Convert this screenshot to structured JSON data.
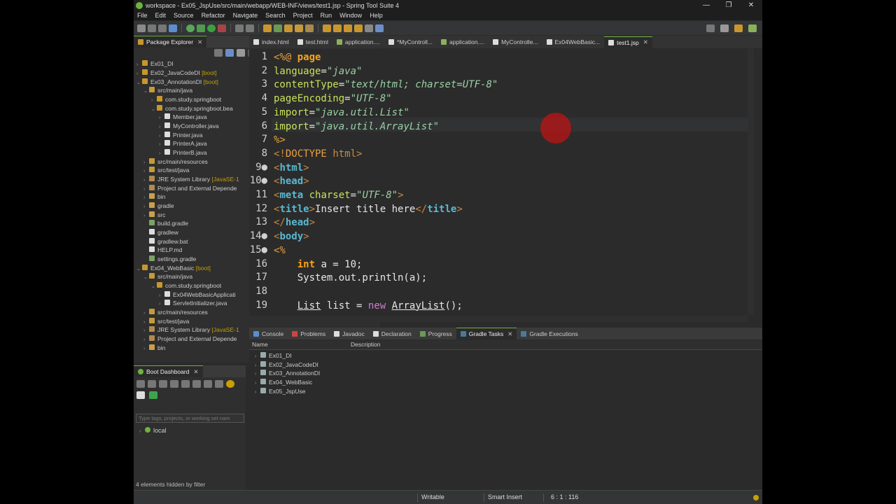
{
  "window": {
    "title": "workspace - Ex05_JspUse/src/main/webapp/WEB-INF/views/test1.jsp - Spring Tool Suite 4",
    "controls": [
      "—",
      "❐",
      "✕"
    ]
  },
  "menu": [
    "File",
    "Edit",
    "Source",
    "Refactor",
    "Navigate",
    "Search",
    "Project",
    "Run",
    "Window",
    "Help"
  ],
  "package_explorer": {
    "title": "Package Explorer",
    "items": [
      {
        "label": "Ex01_DI",
        "suffix": ""
      },
      {
        "label": "Ex02_JavaCodeDI",
        "suffix": "[boot]"
      },
      {
        "label": "Ex03_AnnotationDI",
        "suffix": "[boot]"
      },
      {
        "label": "src/main/java",
        "suffix": ""
      },
      {
        "label": "com.study.springboot",
        "suffix": ""
      },
      {
        "label": "com.study.springboot.bea",
        "suffix": ""
      },
      {
        "label": "Member.java",
        "suffix": ""
      },
      {
        "label": "MyController.java",
        "suffix": ""
      },
      {
        "label": "Printer.java",
        "suffix": ""
      },
      {
        "label": "PrinterA.java",
        "suffix": ""
      },
      {
        "label": "PrinterB.java",
        "suffix": ""
      },
      {
        "label": "src/main/resources",
        "suffix": ""
      },
      {
        "label": "src/test/java",
        "suffix": ""
      },
      {
        "label": "JRE System Library",
        "suffix": "[JavaSE-1"
      },
      {
        "label": "Project and External Depende",
        "suffix": ""
      },
      {
        "label": "bin",
        "suffix": ""
      },
      {
        "label": "gradle",
        "suffix": ""
      },
      {
        "label": "src",
        "suffix": ""
      },
      {
        "label": "build.gradle",
        "suffix": ""
      },
      {
        "label": "gradlew",
        "suffix": ""
      },
      {
        "label": "gradlew.bat",
        "suffix": ""
      },
      {
        "label": "HELP.md",
        "suffix": ""
      },
      {
        "label": "settings.gradle",
        "suffix": ""
      },
      {
        "label": "Ex04_WebBasic",
        "suffix": "[boot]"
      },
      {
        "label": "src/main/java",
        "suffix": ""
      },
      {
        "label": "com.study.springboot",
        "suffix": ""
      },
      {
        "label": "Ex04WebBasicApplicati",
        "suffix": ""
      },
      {
        "label": "ServletInitializer.java",
        "suffix": ""
      },
      {
        "label": "src/main/resources",
        "suffix": ""
      },
      {
        "label": "src/test/java",
        "suffix": ""
      },
      {
        "label": "JRE System Library",
        "suffix": "[JavaSE-1"
      },
      {
        "label": "Project and External Depende",
        "suffix": ""
      },
      {
        "label": "bin",
        "suffix": ""
      }
    ]
  },
  "editor_tabs": [
    "index.html",
    "test.html",
    "application....",
    "*MyControll...",
    "application....",
    "MyControlle...",
    "Ex04WebBasic...",
    "test1.jsp"
  ],
  "editor": {
    "lines": [
      {
        "n": "1",
        "html": "<span class='t'>&lt;%@</span> <span class='k'>page</span>"
      },
      {
        "n": "2",
        "html": "<span class='a'>language</span>=<span class='s'>\"java\"</span>"
      },
      {
        "n": "3",
        "html": "<span class='a'>contentType</span>=<span class='s'>\"text/html; charset=UTF-8\"</span>"
      },
      {
        "n": "4",
        "html": "<span class='a'>pageEncoding</span>=<span class='s'>\"UTF-8\"</span>"
      },
      {
        "n": "5",
        "html": "<span class='a'>import</span>=<span class='s'>\"java.util.List\"</span>"
      },
      {
        "n": "6",
        "html": "<span class='a'>import</span>=<span class='s'>\"java.util.ArrayList\"</span>"
      },
      {
        "n": "7",
        "html": "<span class='t'>%&gt;</span>"
      },
      {
        "n": "8",
        "html": "<span class='p'>&lt;!</span><span class='t'>DOCTYPE</span> <span class='p'>html&gt;</span>"
      },
      {
        "n": "9●",
        "html": "<span class='p'>&lt;</span><span class='tag'>html</span><span class='p'>&gt;</span>"
      },
      {
        "n": "10●",
        "html": "<span class='p'>&lt;</span><span class='tag'>head</span><span class='p'>&gt;</span>"
      },
      {
        "n": "11",
        "html": "<span class='p'>&lt;</span><span class='tag'>meta</span> <span class='a'>charset</span>=<span class='s'>\"UTF-8\"</span><span class='p'>&gt;</span>"
      },
      {
        "n": "12",
        "html": "<span class='p'>&lt;</span><span class='tag'>title</span><span class='p'>&gt;</span>Insert title here<span class='p'>&lt;/</span><span class='tag'>title</span><span class='p'>&gt;</span>"
      },
      {
        "n": "13",
        "html": "<span class='p'>&lt;/</span><span class='tag'>head</span><span class='p'>&gt;</span>"
      },
      {
        "n": "14●",
        "html": "<span class='p'>&lt;</span><span class='tag'>body</span><span class='p'>&gt;</span>"
      },
      {
        "n": "15●",
        "html": "<span class='t'>&lt;%</span>"
      },
      {
        "n": "16",
        "html": "    <span class='k'>int</span> a = 10;"
      },
      {
        "n": "17",
        "html": "    System.out.println(a);"
      },
      {
        "n": "18",
        "html": ""
      },
      {
        "n": "19",
        "html": "    <u>List</u> list = <span class='kw'>new</span> <u>ArrayList</u>();"
      }
    ]
  },
  "bottom_tabs": [
    "Console",
    "Problems",
    "Javadoc",
    "Declaration",
    "Progress",
    "Gradle Tasks",
    "Gradle Executions"
  ],
  "gradle_tasks": {
    "columns": [
      "Name",
      "Description"
    ],
    "rows": [
      "Ex01_DI",
      "Ex02_JavaCodeDI",
      "Ex03_AnnotationDI",
      "Ex04_WebBasic",
      "Ex05_JspUse"
    ]
  },
  "boot_dashboard": {
    "title": "Boot Dashboard",
    "filter_placeholder": "Type tags, projects, or working set nam",
    "items": [
      "local"
    ],
    "footer": "4 elements hidden by filter"
  },
  "status": {
    "writable": "Writable",
    "insert_mode": "Smart Insert",
    "position": "6 : 1 : 116"
  }
}
